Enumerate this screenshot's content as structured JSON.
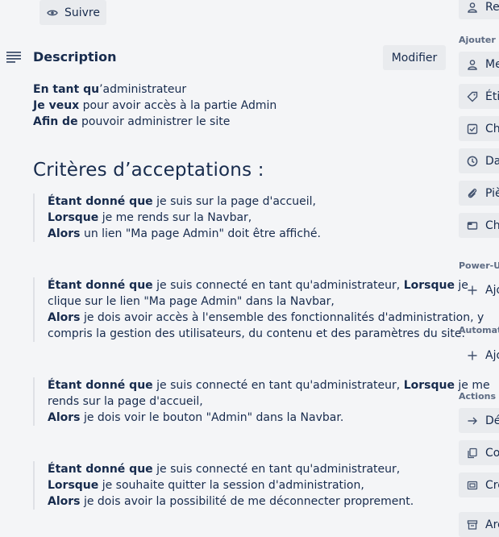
{
  "header": {
    "watch_label": "Suivre"
  },
  "description": {
    "title": "Description",
    "edit_label": "Modifier",
    "story": [
      {
        "bold": "En tant qu",
        "rest": "’administrateur"
      },
      {
        "bold": "Je veux",
        "rest": " pour avoir accès à la partie Admin"
      },
      {
        "bold": "Afin de",
        "rest": " pouvoir administrer le site"
      }
    ],
    "criteria_heading": "Critères d’acceptations :",
    "criteria": [
      {
        "lines": [
          {
            "parts": [
              {
                "b": "Étant donné que"
              },
              {
                "t": " je suis sur la page d'accueil,"
              }
            ]
          },
          {
            "parts": [
              {
                "b": "Lorsque"
              },
              {
                "t": " je me rends sur la Navbar,"
              }
            ]
          },
          {
            "parts": [
              {
                "b": "Alors"
              },
              {
                "t": " un lien \"Ma page Admin\" doit être affiché."
              }
            ]
          }
        ]
      },
      {
        "lines": [
          {
            "parts": [
              {
                "b": "Étant donné que"
              },
              {
                "t": " je suis connecté en tant qu'administrateur, "
              },
              {
                "b": "Lorsque"
              },
              {
                "t": " je"
              }
            ]
          },
          {
            "parts": [
              {
                "t": "clique sur le lien \"Ma page Admin\" dans la Navbar,"
              }
            ]
          },
          {
            "parts": [
              {
                "b": "Alors"
              },
              {
                "t": " je dois avoir accès à l'ensemble des fonctionnalités d'administration, y"
              }
            ]
          },
          {
            "parts": [
              {
                "t": "compris la gestion des utilisateurs, du contenu et des paramètres du site."
              }
            ]
          }
        ]
      },
      {
        "lines": [
          {
            "parts": [
              {
                "b": "Étant donné que"
              },
              {
                "t": " je suis connecté en tant qu'administrateur, "
              },
              {
                "b": "Lorsque"
              },
              {
                "t": " je me"
              }
            ]
          },
          {
            "parts": [
              {
                "t": "rends sur la page d'accueil,"
              }
            ]
          },
          {
            "parts": [
              {
                "b": "Alors"
              },
              {
                "t": " je dois voir le bouton \"Admin\" dans la Navbar."
              }
            ]
          }
        ]
      },
      {
        "lines": [
          {
            "parts": [
              {
                "b": "Étant donné que"
              },
              {
                "t": " je suis connecté en tant qu'administrateur,"
              }
            ]
          },
          {
            "parts": [
              {
                "b": "Lorsque"
              },
              {
                "t": " je souhaite quitter la session d'administration,"
              }
            ]
          },
          {
            "parts": [
              {
                "b": "Alors"
              },
              {
                "t": " je dois avoir la possibilité de me déconnecter proprement."
              }
            ]
          }
        ]
      }
    ]
  },
  "sidebar": {
    "top_button": "Re",
    "add_heading": "Ajouter à",
    "add_items": [
      {
        "label": "Me",
        "icon": "person-icon"
      },
      {
        "label": "Éti",
        "icon": "label-icon"
      },
      {
        "label": "Ch",
        "icon": "checklist-icon"
      },
      {
        "label": "Da",
        "icon": "clock-icon"
      },
      {
        "label": "Piè",
        "icon": "paperclip-icon"
      },
      {
        "label": "Cha",
        "icon": "card-icon"
      }
    ],
    "powerups_heading": "Power-Up",
    "powerups_add": "Ajo",
    "automation_heading": "Automat",
    "automation_add": "Ajo",
    "actions_heading": "Actions",
    "actions": [
      {
        "label": "Dé",
        "icon": "arrow-right-icon"
      },
      {
        "label": "Co",
        "icon": "copy-icon"
      },
      {
        "label": "Cré",
        "icon": "template-icon"
      },
      {
        "label": "Arc",
        "icon": "archive-icon"
      }
    ]
  }
}
